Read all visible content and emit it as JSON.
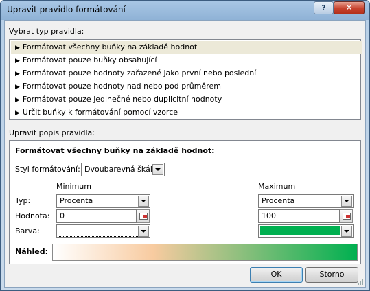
{
  "window": {
    "title": "Upravit pravidlo formátování",
    "help_label": "?",
    "close_label": "✕"
  },
  "rule_type": {
    "label": "Vybrat typ pravidla:",
    "items": [
      {
        "label": "Formátovat všechny buňky na základě hodnot",
        "selected": true
      },
      {
        "label": "Formátovat pouze buňky obsahující",
        "selected": false
      },
      {
        "label": "Formátovat pouze hodnoty zařazené jako první nebo poslední",
        "selected": false
      },
      {
        "label": "Formátovat pouze hodnoty nad nebo pod průměrem",
        "selected": false
      },
      {
        "label": "Formátovat pouze jedinečné nebo duplicitní hodnoty",
        "selected": false
      },
      {
        "label": "Určit buňky k formátování pomocí vzorce",
        "selected": false
      }
    ]
  },
  "description": {
    "label": "Upravit popis pravidla:",
    "heading": "Formátovat všechny buňky na základě hodnot:",
    "style_label": "Styl formátování:",
    "style_value": "Dvoubarevná škála",
    "minimum_label": "Minimum",
    "maximum_label": "Maximum",
    "type_label": "Typ:",
    "value_label": "Hodnota:",
    "color_label": "Barva:",
    "min": {
      "type": "Procenta",
      "value": "0",
      "color": "#ffffff"
    },
    "max": {
      "type": "Procenta",
      "value": "100",
      "color": "#00b050"
    },
    "preview_label": "Náhled:",
    "preview_gradient": [
      "#ffffff",
      "#f8cba0",
      "#00b050"
    ]
  },
  "buttons": {
    "ok": "OK",
    "cancel": "Storno"
  }
}
